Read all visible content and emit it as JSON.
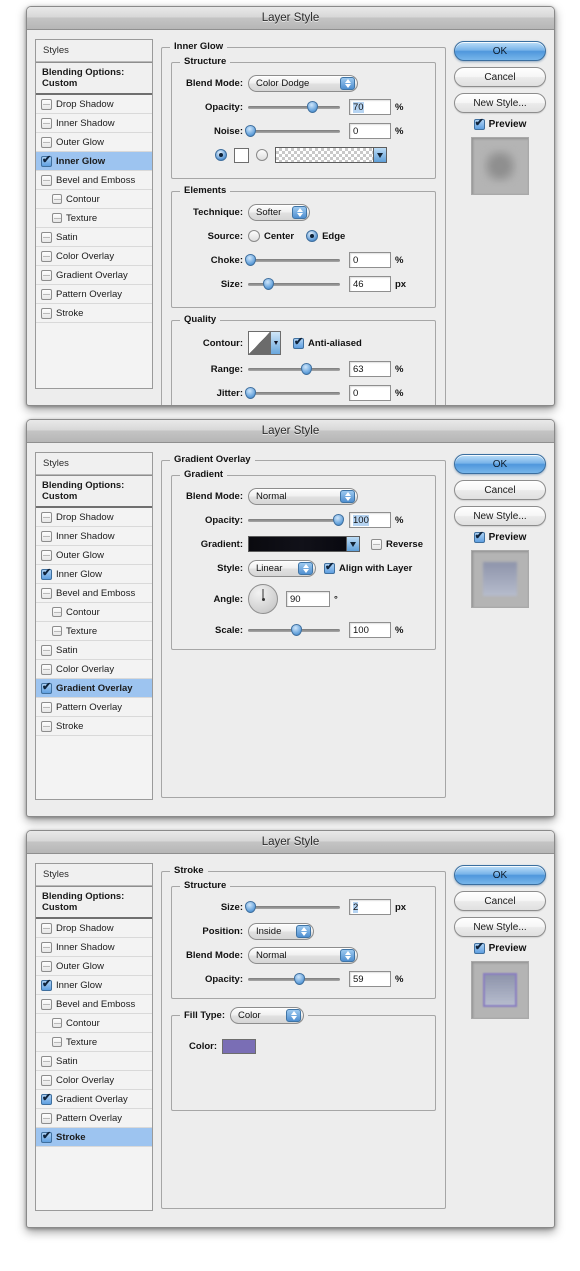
{
  "window": {
    "title": "Layer Style"
  },
  "styles_panel": {
    "header": "Styles",
    "blending_options": "Blending Options: Custom",
    "items": [
      {
        "label": "Drop Shadow",
        "checked": false,
        "sub": false
      },
      {
        "label": "Inner Shadow",
        "checked": false,
        "sub": false
      },
      {
        "label": "Outer Glow",
        "checked": false,
        "sub": false
      },
      {
        "label": "Inner Glow",
        "checked": true,
        "sub": false
      },
      {
        "label": "Bevel and Emboss",
        "checked": false,
        "sub": false
      },
      {
        "label": "Contour",
        "checked": false,
        "sub": true
      },
      {
        "label": "Texture",
        "checked": false,
        "sub": true
      },
      {
        "label": "Satin",
        "checked": false,
        "sub": false
      },
      {
        "label": "Color Overlay",
        "checked": false,
        "sub": false
      },
      {
        "label": "Gradient Overlay",
        "checked": false,
        "sub": false
      },
      {
        "label": "Pattern Overlay",
        "checked": false,
        "sub": false
      },
      {
        "label": "Stroke",
        "checked": false,
        "sub": false
      }
    ]
  },
  "buttons": {
    "ok": "OK",
    "cancel": "Cancel",
    "new_style": "New Style...",
    "preview": "Preview",
    "preview_checked": true
  },
  "colors": {
    "selection_blue": "#9dc4f0",
    "primary_button": "#4f97dc",
    "stroke_color_swatch": "#7a6eb5",
    "gradient_swatch": "#0a0a0f"
  },
  "panels": [
    {
      "id": "inner-glow",
      "effect_title": "Inner Glow",
      "selected_style": "Inner Glow",
      "checked_styles": [
        "Inner Glow"
      ],
      "groups": [
        {
          "legend": "Structure",
          "fields": {
            "blend_mode_label": "Blend Mode:",
            "blend_mode_value": "Color Dodge",
            "opacity_label": "Opacity:",
            "opacity_value": "70",
            "opacity_unit": "%",
            "opacity_pct": 70,
            "noise_label": "Noise:",
            "noise_value": "0",
            "noise_unit": "%",
            "noise_pct": 0,
            "fill_mode": "color",
            "color_swatch": "#ffffff",
            "gradient_type": "checkerboard"
          }
        },
        {
          "legend": "Elements",
          "fields": {
            "technique_label": "Technique:",
            "technique_value": "Softer",
            "source_label": "Source:",
            "source_center": "Center",
            "source_edge": "Edge",
            "source_selected": "Edge",
            "choke_label": "Choke:",
            "choke_value": "0",
            "choke_unit": "%",
            "choke_pct": 0,
            "size_label": "Size:",
            "size_value": "46",
            "size_unit": "px",
            "size_pct": 22
          }
        },
        {
          "legend": "Quality",
          "fields": {
            "contour_label": "Contour:",
            "anti_aliased_label": "Anti-aliased",
            "anti_aliased_checked": true,
            "range_label": "Range:",
            "range_value": "63",
            "range_unit": "%",
            "range_pct": 63,
            "jitter_label": "Jitter:",
            "jitter_value": "0",
            "jitter_unit": "%",
            "jitter_pct": 0
          }
        }
      ]
    },
    {
      "id": "gradient-overlay",
      "effect_title": "Gradient Overlay",
      "selected_style": "Gradient Overlay",
      "checked_styles": [
        "Inner Glow",
        "Gradient Overlay"
      ],
      "groups": [
        {
          "legend": "Gradient",
          "fields": {
            "blend_mode_label": "Blend Mode:",
            "blend_mode_value": "Normal",
            "opacity_label": "Opacity:",
            "opacity_value": "100",
            "opacity_unit": "%",
            "opacity_pct": 100,
            "gradient_label": "Gradient:",
            "reverse_label": "Reverse",
            "reverse_checked": false,
            "style_label": "Style:",
            "style_value": "Linear",
            "align_label": "Align with Layer",
            "align_checked": true,
            "angle_label": "Angle:",
            "angle_value": "90",
            "angle_unit": "°",
            "scale_label": "Scale:",
            "scale_value": "100",
            "scale_unit": "%",
            "scale_pct": 52
          }
        }
      ]
    },
    {
      "id": "stroke",
      "effect_title": "Stroke",
      "selected_style": "Stroke",
      "checked_styles": [
        "Inner Glow",
        "Gradient Overlay",
        "Stroke"
      ],
      "groups": [
        {
          "legend": "Structure",
          "fields": {
            "size_label": "Size:",
            "size_value": "2",
            "size_unit": "px",
            "size_pct": 2,
            "position_label": "Position:",
            "position_value": "Inside",
            "blend_mode_label": "Blend Mode:",
            "blend_mode_value": "Normal",
            "opacity_label": "Opacity:",
            "opacity_value": "59",
            "opacity_unit": "%",
            "opacity_pct": 59
          }
        },
        {
          "legend": "Fill Type:",
          "fill_type_value": "Color",
          "fields": {
            "color_label": "Color:",
            "color_value": "#7a6eb5"
          }
        }
      ]
    }
  ]
}
